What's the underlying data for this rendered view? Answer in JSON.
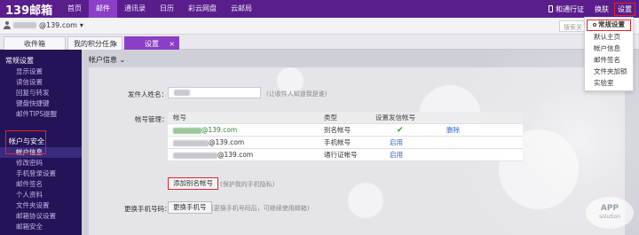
{
  "topbar": {
    "logo": "139邮箱",
    "nav": [
      "首页",
      "邮件",
      "通讯录",
      "日历",
      "彩云网盘",
      "云邮局"
    ],
    "active_nav": "邮件",
    "right": {
      "tongxing": "和通行证",
      "skin": "换肤",
      "settings": "设置"
    }
  },
  "userbar": {
    "account_suffix": "@139.com",
    "search_placeholder": "搜索关"
  },
  "tabs": [
    {
      "label": "收件箱"
    },
    {
      "label": "我的积分任务",
      "close": "×"
    },
    {
      "label": "设置",
      "close": "×"
    }
  ],
  "sidebar": {
    "group1": "常规设置",
    "group1_items": [
      "显示设置",
      "读信设置",
      "回复与转发",
      "键盘快捷键",
      "邮件TIPS提醒"
    ],
    "group2": "帐户与安全",
    "group2_items": [
      "帐户信息",
      "修改密码",
      "手机登录设置",
      "邮件签名",
      "个人资料",
      "文件夹设置",
      "邮箱协议设置",
      "邮箱安全"
    ]
  },
  "content": {
    "header": "帐户信息 ⌄",
    "sender_label": "发件人姓名：",
    "sender_hint": "(让收件人知道我是谁)",
    "account_mgmt_label": "帐号管理：",
    "table": {
      "headers": [
        "帐号",
        "类型",
        "设置发信帐号",
        ""
      ],
      "rows": [
        {
          "account": "@139.com",
          "type": "别名帐号",
          "send": "✔",
          "action": "删除"
        },
        {
          "account": "@139.com",
          "type": "手机帐号",
          "send": "启用",
          "action": ""
        },
        {
          "account": "@139.com",
          "type": "通行证帐号",
          "send": "启用",
          "action": ""
        }
      ]
    },
    "add_alias_button": "添加别名帐号",
    "add_alias_hint": "(保护我的手机隐私)",
    "change_phone_label": "更换手机号码：",
    "change_phone_button": "更换手机号",
    "change_phone_hint": "(更换手机号码后，可继续使用邮箱)"
  },
  "dropdown": [
    "常规设置",
    "默认主页",
    "帐户信息",
    "邮件签名",
    "文件夹加锁",
    "实验室"
  ],
  "watermark": {
    "main": "APP",
    "sub": "solution"
  }
}
